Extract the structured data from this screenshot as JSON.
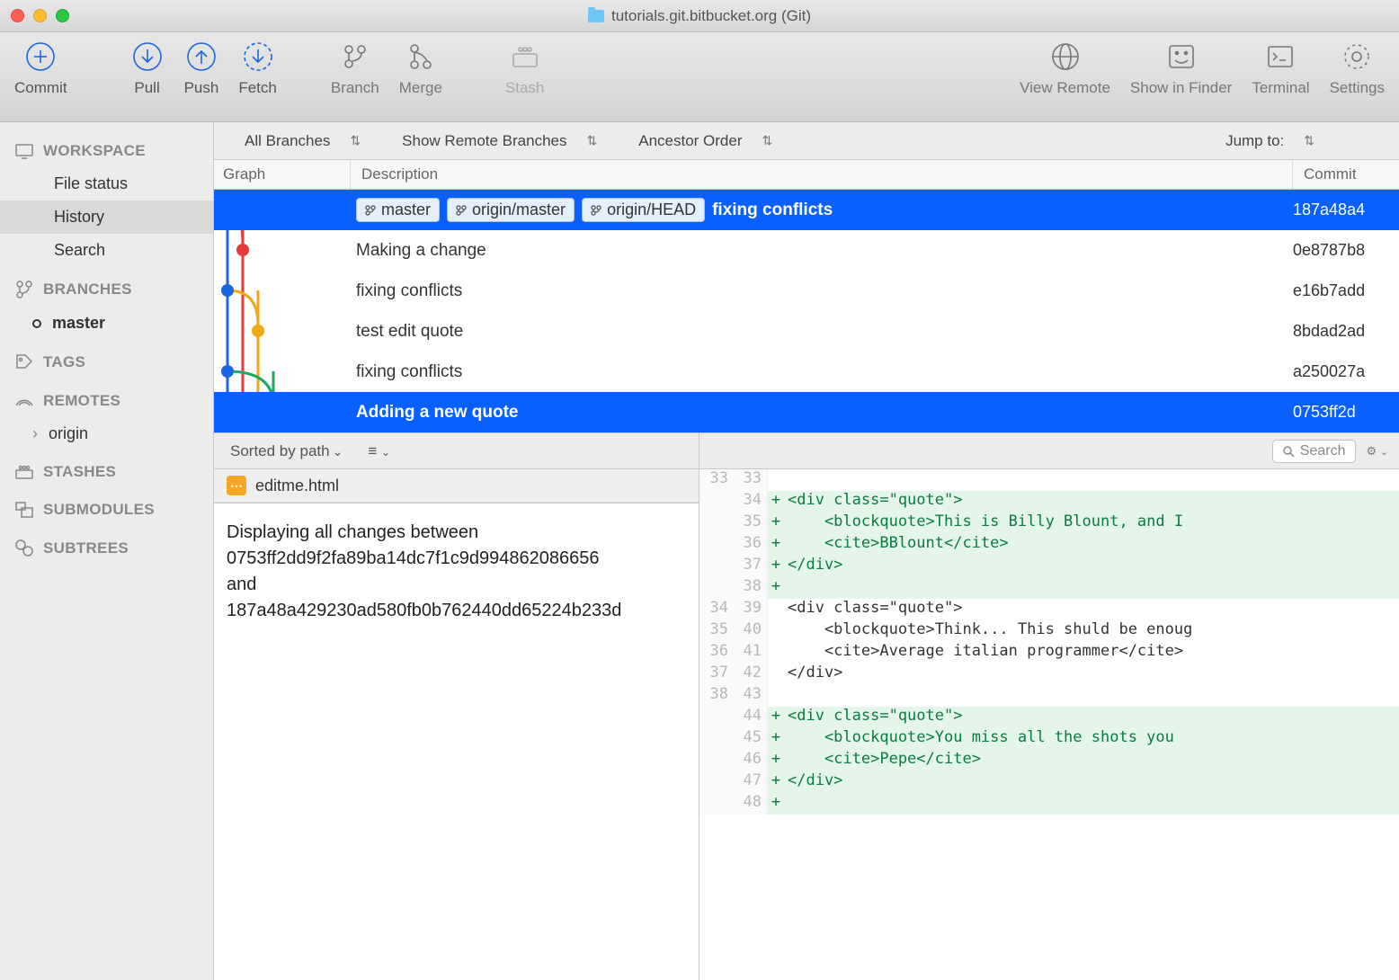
{
  "window": {
    "title": "tutorials.git.bitbucket.org (Git)"
  },
  "toolbar": {
    "commit": "Commit",
    "pull": "Pull",
    "push": "Push",
    "fetch": "Fetch",
    "branch": "Branch",
    "merge": "Merge",
    "stash": "Stash",
    "view_remote": "View Remote",
    "show_in_finder": "Show in Finder",
    "terminal": "Terminal",
    "settings": "Settings"
  },
  "filters": {
    "branches": "All Branches",
    "remote": "Show Remote Branches",
    "order": "Ancestor Order",
    "jump": "Jump to:"
  },
  "columns": {
    "graph": "Graph",
    "desc": "Description",
    "commit": "Commit"
  },
  "sidebar": {
    "workspace": {
      "label": "WORKSPACE",
      "items": [
        "File status",
        "History",
        "Search"
      ]
    },
    "branches": {
      "label": "BRANCHES",
      "items": [
        "master"
      ]
    },
    "tags": {
      "label": "TAGS"
    },
    "remotes": {
      "label": "REMOTES",
      "items": [
        "origin"
      ]
    },
    "stashes": {
      "label": "STASHES"
    },
    "submodules": {
      "label": "SUBMODULES"
    },
    "subtrees": {
      "label": "SUBTREES"
    }
  },
  "commits": [
    {
      "tags": [
        "master",
        "origin/master",
        "origin/HEAD"
      ],
      "desc": "fixing conflicts",
      "hash": "187a48a4",
      "selected": true
    },
    {
      "tags": [],
      "desc": "Making a change",
      "hash": "0e8787b8"
    },
    {
      "tags": [],
      "desc": "fixing conflicts",
      "hash": "e16b7add"
    },
    {
      "tags": [],
      "desc": "test edit quote",
      "hash": "8bdad2ad"
    },
    {
      "tags": [],
      "desc": "fixing conflicts",
      "hash": "a250027a"
    },
    {
      "tags": [],
      "desc": "Adding a new quote",
      "hash": "0753ff2d",
      "selected": true
    }
  ],
  "bottom": {
    "sort": "Sorted by path",
    "file": "editme.html",
    "search_placeholder": "Search",
    "message_lines": [
      "Displaying all changes between",
      "0753ff2dd9f2fa89ba14dc7f1c9d994862086656",
      "and",
      "187a48a429230ad580fb0b762440dd65224b233d"
    ],
    "diff": [
      {
        "old": "33",
        "new": "33",
        "t": "ctx",
        "text": ""
      },
      {
        "old": "",
        "new": "34",
        "t": "add",
        "text": "<div class=\"quote\">"
      },
      {
        "old": "",
        "new": "35",
        "t": "add",
        "text": "    <blockquote>This is Billy Blount, and I"
      },
      {
        "old": "",
        "new": "36",
        "t": "add",
        "text": "    <cite>BBlount</cite>"
      },
      {
        "old": "",
        "new": "37",
        "t": "add",
        "text": "</div>"
      },
      {
        "old": "",
        "new": "38",
        "t": "add",
        "text": ""
      },
      {
        "old": "34",
        "new": "39",
        "t": "ctx",
        "text": "<div class=\"quote\">"
      },
      {
        "old": "35",
        "new": "40",
        "t": "ctx",
        "text": "    <blockquote>Think... This shuld be enoug"
      },
      {
        "old": "36",
        "new": "41",
        "t": "ctx",
        "text": "    <cite>Average italian programmer</cite>"
      },
      {
        "old": "37",
        "new": "42",
        "t": "ctx",
        "text": "</div>"
      },
      {
        "old": "38",
        "new": "43",
        "t": "ctx",
        "text": ""
      },
      {
        "old": "",
        "new": "44",
        "t": "add",
        "text": "<div class=\"quote\">"
      },
      {
        "old": "",
        "new": "45",
        "t": "add",
        "text": "    <blockquote>You miss all the shots you"
      },
      {
        "old": "",
        "new": "46",
        "t": "add",
        "text": "    <cite>Pepe</cite>"
      },
      {
        "old": "",
        "new": "47",
        "t": "add",
        "text": "</div>"
      },
      {
        "old": "",
        "new": "48",
        "t": "add",
        "text": ""
      }
    ]
  }
}
